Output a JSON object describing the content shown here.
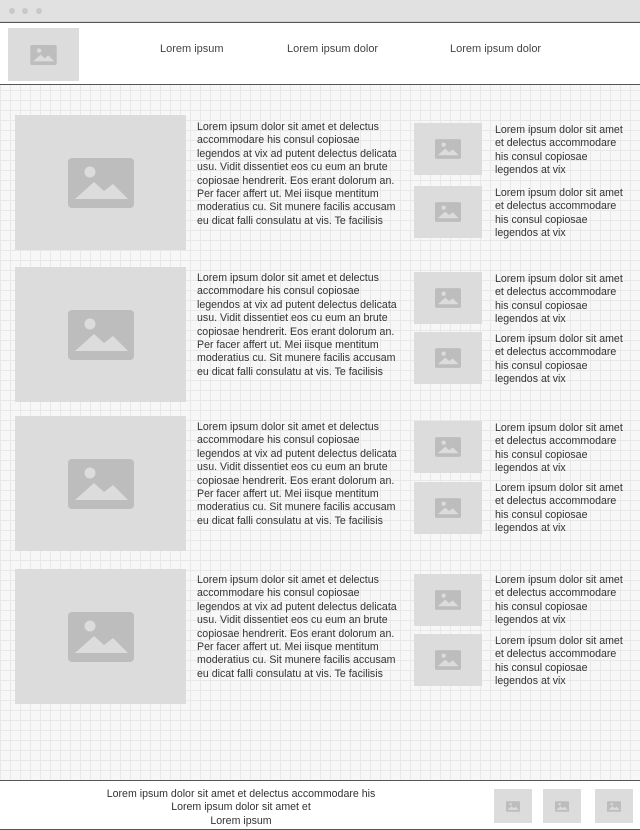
{
  "header": {
    "logo_icon": "image-placeholder-icon",
    "nav": [
      {
        "label": "Lorem ipsum"
      },
      {
        "label": "Lorem ipsum dolor"
      },
      {
        "label": "Lorem ipsum dolor"
      }
    ]
  },
  "rows": [
    {
      "article_text": "Lorem ipsum dolor sit amet et delectus accommodare his consul copiosae legendos at vix ad putent delectus delicata usu. Vidit dissentiet eos cu eum an brute copiosae hendrerit. Eos erant dolorum an. Per facer affert ut. Mei iisque mentitum moderatius cu. Sit munere facilis accusam eu dicat falli consulatu at vis. Te facilisis",
      "side": [
        {
          "text": "Lorem ipsum dolor sit amet et delectus accommodare his consul copiosae legendos at vix"
        },
        {
          "text": "Lorem ipsum dolor sit amet et delectus accommodare his consul copiosae legendos at vix"
        }
      ]
    },
    {
      "article_text": "Lorem ipsum dolor sit amet et delectus accommodare his consul copiosae legendos at vix ad putent delectus delicata usu. Vidit dissentiet eos cu eum an brute copiosae hendrerit. Eos erant dolorum an. Per facer affert ut. Mei iisque mentitum moderatius cu. Sit munere facilis accusam eu dicat falli consulatu at vis. Te facilisis",
      "side": [
        {
          "text": "Lorem ipsum dolor sit amet et delectus accommodare his consul copiosae legendos at vix"
        },
        {
          "text": "Lorem ipsum dolor sit amet et delectus accommodare his consul copiosae legendos at vix"
        }
      ]
    },
    {
      "article_text": "Lorem ipsum dolor sit amet et delectus accommodare his consul copiosae legendos at vix ad putent delectus delicata usu. Vidit dissentiet eos cu eum an brute copiosae hendrerit. Eos erant dolorum an. Per facer affert ut. Mei iisque mentitum moderatius cu. Sit munere facilis accusam eu dicat falli consulatu at vis. Te facilisis",
      "side": [
        {
          "text": "Lorem ipsum dolor sit amet et delectus accommodare his consul copiosae legendos at vix"
        },
        {
          "text": "Lorem ipsum dolor sit amet et delectus accommodare his consul copiosae legendos at vix"
        }
      ]
    },
    {
      "article_text": "Lorem ipsum dolor sit amet et delectus accommodare his consul copiosae legendos at vix ad putent delectus delicata usu. Vidit dissentiet eos cu eum an brute copiosae hendrerit. Eos erant dolorum an. Per facer affert ut. Mei iisque mentitum moderatius cu. Sit munere facilis accusam eu dicat falli consulatu at vis. Te facilisis",
      "side": [
        {
          "text": "Lorem ipsum dolor sit amet et delectus accommodare his consul copiosae legendos at vix"
        },
        {
          "text": "Lorem ipsum dolor sit amet et delectus accommodare his consul copiosae legendos at vix"
        }
      ]
    }
  ],
  "footer": {
    "lines": [
      "Lorem ipsum dolor sit amet et delectus accommodare his",
      "Lorem ipsum dolor sit amet et",
      "Lorem ipsum"
    ],
    "icons": [
      "image-placeholder-icon",
      "image-placeholder-icon",
      "image-placeholder-icon"
    ]
  },
  "colors": {
    "placeholder": "#dcdcdc",
    "placeholder_icon": "#bdbdbd",
    "border": "#555555"
  }
}
